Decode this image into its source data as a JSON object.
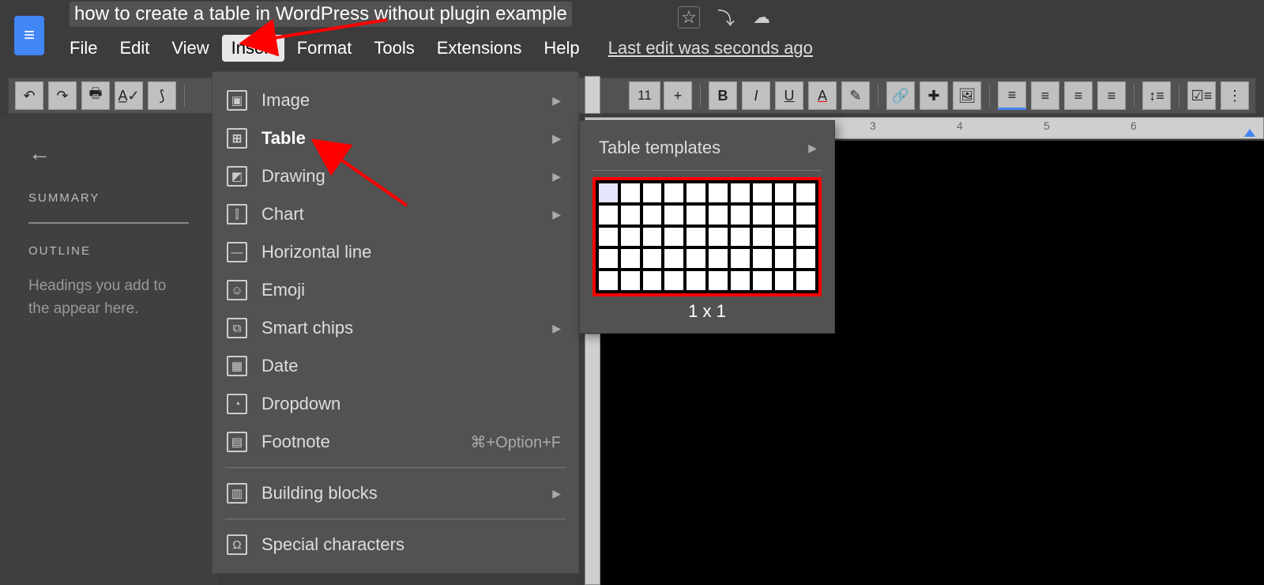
{
  "title": "how to create a table in WordPress without plugin example",
  "menubar": {
    "file": "File",
    "edit": "Edit",
    "view": "View",
    "insert": "Insert",
    "format": "Format",
    "tools": "Tools",
    "extensions": "Extensions",
    "help": "Help",
    "last_edit": "Last edit was seconds ago"
  },
  "toolbar": {
    "font_size": "11"
  },
  "sidebar": {
    "summary": "SUMMARY",
    "outline": "OUTLINE",
    "hint": "Headings you add to the appear here."
  },
  "ruler": {
    "n3": "3",
    "n4": "4",
    "n5": "5",
    "n6": "6"
  },
  "insert_menu": {
    "image": "Image",
    "table": "Table",
    "drawing": "Drawing",
    "chart": "Chart",
    "horizontal_line": "Horizontal line",
    "emoji": "Emoji",
    "smart_chips": "Smart chips",
    "date": "Date",
    "dropdown": "Dropdown",
    "footnote": "Footnote",
    "footnote_shortcut": "⌘+Option+F",
    "building_blocks": "Building blocks",
    "special_characters": "Special characters"
  },
  "table_submenu": {
    "templates": "Table templates",
    "grid_size": "1 x 1"
  }
}
